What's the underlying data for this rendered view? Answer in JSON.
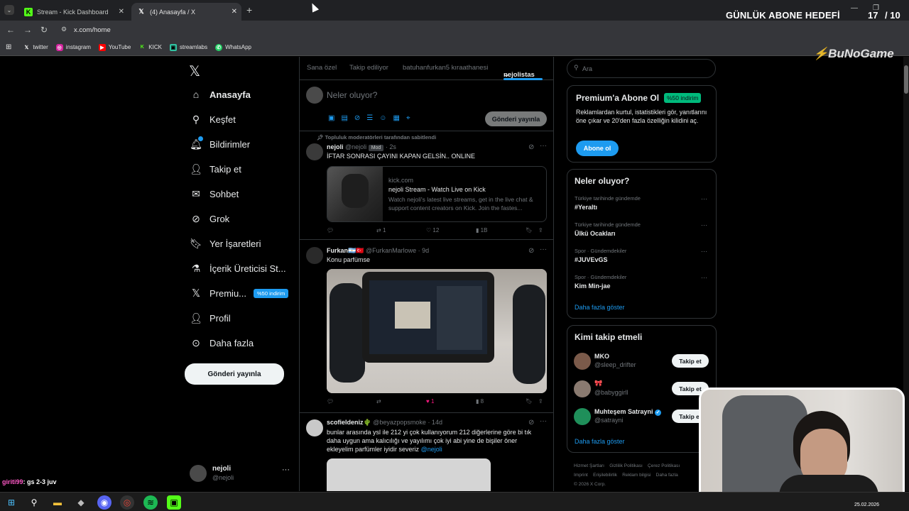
{
  "browser": {
    "tabs": [
      {
        "label": "Stream - Kick Dashboard",
        "icon": "kick-icon"
      },
      {
        "label": "(4) Anasayfa / X",
        "icon": "x-icon"
      }
    ],
    "url": "x.com/home",
    "bookmarks": [
      {
        "label": "twitter",
        "icon": "x-icon"
      },
      {
        "label": "instagram",
        "icon": "instagram-icon"
      },
      {
        "label": "YouTube",
        "icon": "youtube-icon"
      },
      {
        "label": "KICK",
        "icon": "kick-icon"
      },
      {
        "label": "streamlabs",
        "icon": "streamlabs-icon"
      },
      {
        "label": "WhatsApp",
        "icon": "whatsapp-icon"
      }
    ]
  },
  "overlay": {
    "goal_title": "GÜNLÜK ABONE HEDEFİ",
    "goal_current": "17",
    "goal_total": "/ 10",
    "brand": "BuNoGame",
    "chat_user": "giriti99",
    "chat_message": ": gs 2-3 juv",
    "date": "25.02.2026"
  },
  "nav": {
    "items": [
      {
        "label": "Anasayfa",
        "icon": "home-icon"
      },
      {
        "label": "Keşfet",
        "icon": "search-icon"
      },
      {
        "label": "Bildirimler",
        "icon": "bell-icon"
      },
      {
        "label": "Takip et",
        "icon": "add-user-icon"
      },
      {
        "label": "Sohbet",
        "icon": "mail-icon"
      },
      {
        "label": "Grok",
        "icon": "grok-icon"
      },
      {
        "label": "Yer İşaretleri",
        "icon": "bookmark-icon"
      },
      {
        "label": "İçerik Üreticisi St...",
        "icon": "flask-icon"
      },
      {
        "label": "Premiu...",
        "icon": "x-icon"
      },
      {
        "label": "Profil",
        "icon": "user-icon"
      },
      {
        "label": "Daha fazla",
        "icon": "more-circle-icon"
      }
    ],
    "premium_badge": "%50 indirim",
    "post_button": "Gönderi yayınla",
    "account_name": "nejoli",
    "account_handle": "@nejoli"
  },
  "feed": {
    "tabs": [
      "Sana özel",
      "Takip ediliyor",
      "batuhanfurkan5 kıraathanesi",
      "nejolistas"
    ],
    "compose_placeholder": "Neler oluyor?",
    "compose_button": "Gönderi yayınla",
    "pinned_note": "Topluluk moderatörleri tarafından sabitlendi",
    "posts": [
      {
        "name": "nejoli",
        "handle": "@nejoli",
        "badge": "Mod",
        "time": "· 2s",
        "text": "İFTAR SONRASI ÇAYINI KAPAN GELSİN.. ONLINE",
        "link_domain": "kick.com",
        "link_title": "nejoli Stream - Watch Live on Kick",
        "link_desc": "Watch nejoli's latest live streams, get in the live chat & support content creators on Kick. Join the fastes...",
        "retweets": "1",
        "likes": "12",
        "views": "1B"
      },
      {
        "name": "Furkan🇦🇷🇹🇷",
        "handle": "@FurkanMarlowe",
        "time": "· 9d",
        "text": "Konu parfümse",
        "likes": "1",
        "views": "8"
      },
      {
        "name": "scofieldeniz🌵",
        "handle": "@beyazpopsmoke",
        "time": "· 14d",
        "text": "bunlar arasında ysl ile 212 yi çok kullanıyorum 212 diğerlerine göre bi tık daha uygun ama kalıcılığı ve yayılımı çok iyi abi yine de bişiler öner ekleyelim parfümler iyidir severiz",
        "mention": "@nejoli"
      }
    ]
  },
  "sidebar": {
    "search_placeholder": "Ara",
    "premium_title": "Premium'a Abone Ol",
    "premium_badge": "%50 indirim",
    "premium_text": "Reklamlardan kurtul, istatistikleri gör, yanıtlarını öne çıkar ve 20'den fazla özelliğin kilidini aç.",
    "premium_button": "Abone ol",
    "trends_title": "Neler oluyor?",
    "trends": [
      {
        "context": "Türkiye tarihinde gündemde",
        "topic": "#Yeraltı"
      },
      {
        "context": "Türkiye tarihinde gündemde",
        "topic": "Ülkü Ocakları"
      },
      {
        "context": "Spor · Gündemdekiler",
        "topic": "#JUVEvGS"
      },
      {
        "context": "Spor · Gündemdekiler",
        "topic": "Kim Min-jae"
      }
    ],
    "show_more": "Daha fazla göster",
    "who_title": "Kimi takip etmeli",
    "who": [
      {
        "name": "MKO",
        "handle": "@sleep_drifter",
        "button": "Takip et"
      },
      {
        "name": "🎀",
        "handle": "@babyggirll",
        "button": "Takip et"
      },
      {
        "name": "Muhteşem Satrayni",
        "handle": "@satrayni",
        "button": "Takip et"
      }
    ],
    "who_more": "Daha fazla göster",
    "footer": [
      "Hizmet Şartları",
      "Gizlilik Politikası",
      "Çerez Politikası",
      "Imprint",
      "Erişilebilirlik",
      "Reklam bilgisi",
      "Daha fazla",
      "© 2026 X Corp."
    ]
  },
  "colors": {
    "accent": "#1d9bf0",
    "premium_green": "#00ba7c",
    "like_pink": "#f91880"
  }
}
